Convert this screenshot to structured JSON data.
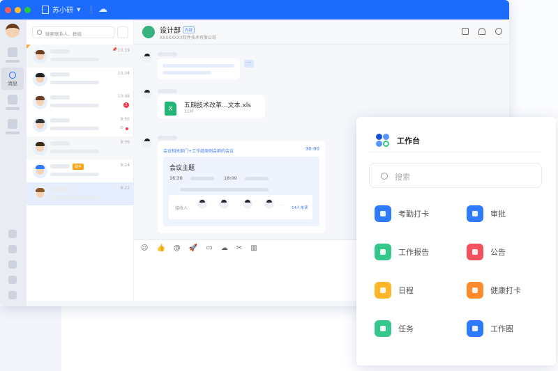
{
  "titlebar": {
    "org": "苏小研",
    "colors": {
      "close": "#fe5f57",
      "min": "#febc2e",
      "max": "#28c840",
      "bar": "#1d6bfd"
    }
  },
  "rail": {
    "active_label": "消息"
  },
  "contacts": {
    "search_placeholder": "搜索联系人、群组",
    "items": [
      {
        "time": "10:19",
        "pinned": true
      },
      {
        "time": "10:34"
      },
      {
        "time": "10:08",
        "unread": "2"
      },
      {
        "time": "9:50",
        "dot": true
      },
      {
        "time": "9:36"
      },
      {
        "time": "9:24",
        "tag": "助手"
      },
      {
        "time": "9:22",
        "selected": true
      }
    ]
  },
  "chat": {
    "title": "设计部",
    "tag": "内部",
    "subtitle": "XXXXXXXX软件技术有限公司",
    "file": {
      "name": "五期技术改革...文本.xls",
      "size": "31M",
      "icon": "X"
    },
    "meeting": {
      "header": "会议相关部门+工作组周例会群的会议",
      "duration": "30:00",
      "subject": "会议主题",
      "start": "16:30",
      "end": "18:00",
      "recipients_label": "接收人:",
      "more": "···",
      "unread": "14人未读"
    },
    "toolbar": [
      "emoji-icon",
      "thumbs-up-icon",
      "at-icon",
      "rocket-icon",
      "folder-icon",
      "cloud-icon",
      "scissors-icon",
      "chart-icon"
    ]
  },
  "toolbar_glyphs": [
    "☺",
    "👍",
    "@",
    "🚀",
    "▭",
    "☁",
    "✂",
    "▥"
  ],
  "workbench": {
    "title": "工作台",
    "search_placeholder": "搜索",
    "apps": [
      {
        "label": "考勤打卡",
        "color": "#2f7bff"
      },
      {
        "label": "审批",
        "color": "#2f7bff"
      },
      {
        "label": "工作报告",
        "color": "#34c98a"
      },
      {
        "label": "公告",
        "color": "#f4515f"
      },
      {
        "label": "日程",
        "color": "#ffb629"
      },
      {
        "label": "健康打卡",
        "color": "#ff8a2b"
      },
      {
        "label": "任务",
        "color": "#34c98a"
      },
      {
        "label": "工作圈",
        "color": "#2f7bff"
      }
    ]
  }
}
